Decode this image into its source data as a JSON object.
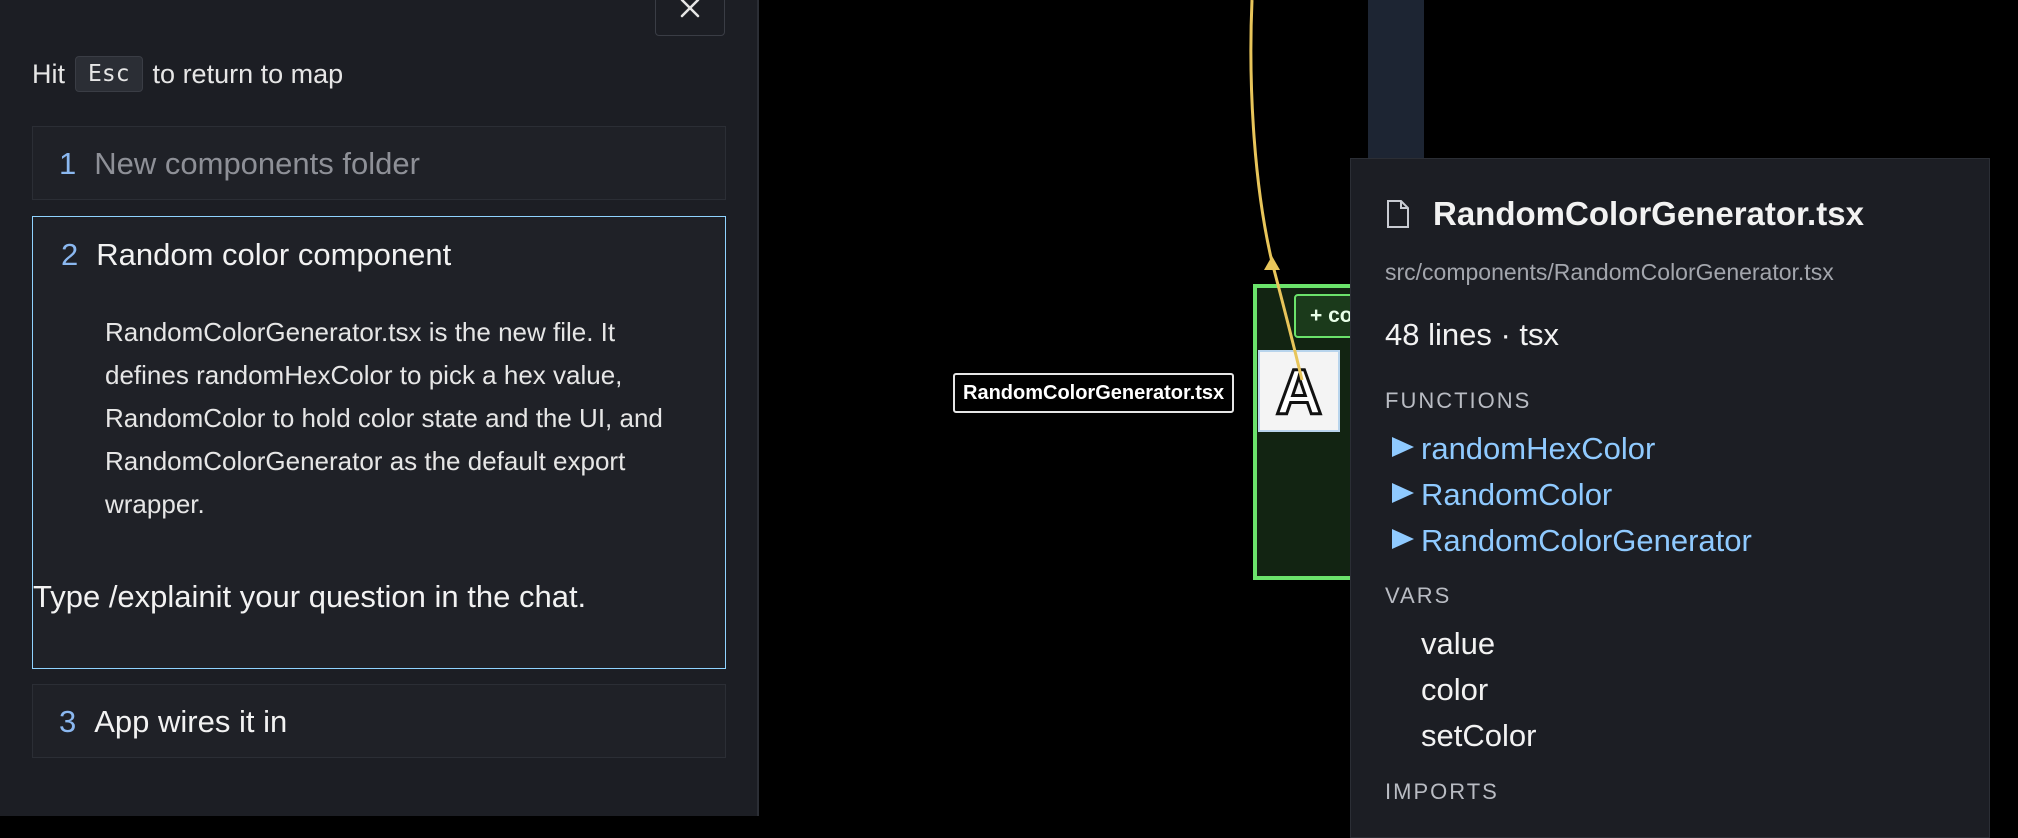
{
  "walkthrough": {
    "close_icon": "close-icon",
    "hint_prefix": "Hit",
    "hint_key": "Esc",
    "hint_suffix": "to return to map",
    "steps": [
      {
        "number": "1",
        "title": "New components folder"
      },
      {
        "number": "2",
        "title": "Random color component",
        "body": "RandomColorGenerator.tsx is the new file. It defines randomHexColor to pick a hex value, RandomColor to hold color state and the UI, and RandomColorGenerator as the default export wrapper.",
        "chat_hint": "Type /explainit your question in the chat."
      },
      {
        "number": "3",
        "title": "App wires it in"
      }
    ]
  },
  "canvas": {
    "file_label": "RandomColorGenerator.tsx",
    "node_button": "+ co",
    "avatar_letter": "A",
    "colors": {
      "node_border": "#6be36b",
      "edge": "#e8c55a",
      "function_link": "#8fcaff"
    }
  },
  "info_panel": {
    "file_icon": "file-icon",
    "title": "RandomColorGenerator.tsx",
    "path": "src/components/RandomColorGenerator.tsx",
    "meta": "48 lines · tsx",
    "functions_heading": "FUNCTIONS",
    "functions": [
      "randomHexColor",
      "RandomColor",
      "RandomColorGenerator"
    ],
    "vars_heading": "VARS",
    "vars": [
      "value",
      "color",
      "setColor"
    ],
    "imports_heading": "IMPORTS"
  }
}
